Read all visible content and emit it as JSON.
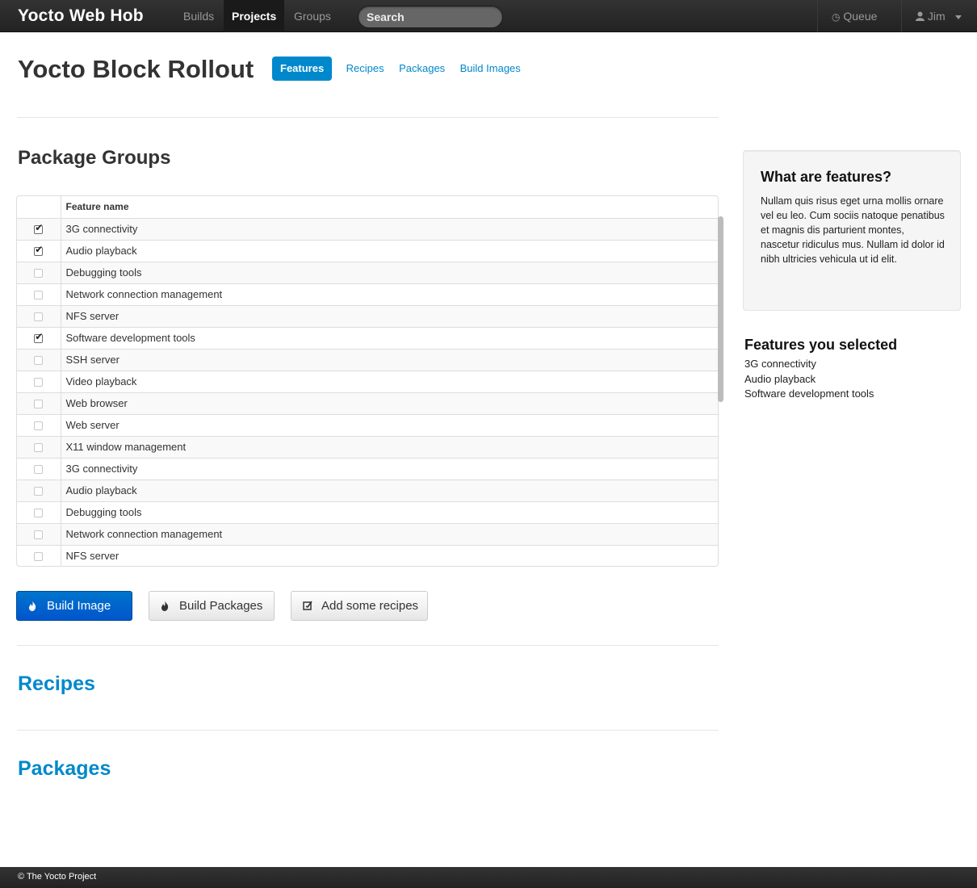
{
  "navbar": {
    "brand": "Yocto Web Hob",
    "links": [
      "Builds",
      "Projects",
      "Groups"
    ],
    "active": "Projects",
    "search_placeholder": "Search",
    "queue_label": "Queue",
    "user_name": "Jim"
  },
  "header": {
    "title": "Yocto Block Rollout",
    "tabs": [
      "Features",
      "Recipes",
      "Packages",
      "Build Images"
    ],
    "active_tab": "Features"
  },
  "package_groups": {
    "title": "Package Groups",
    "column_header": "Feature name",
    "rows": [
      {
        "name": "3G connectivity",
        "checked": true
      },
      {
        "name": "Audio playback",
        "checked": true
      },
      {
        "name": "Debugging tools",
        "checked": false
      },
      {
        "name": "Network connection management",
        "checked": false
      },
      {
        "name": "NFS server",
        "checked": false
      },
      {
        "name": "Software development tools",
        "checked": true
      },
      {
        "name": "SSH server",
        "checked": false
      },
      {
        "name": "Video playback",
        "checked": false
      },
      {
        "name": "Web browser",
        "checked": false
      },
      {
        "name": "Web server",
        "checked": false
      },
      {
        "name": "X11 window management",
        "checked": false
      },
      {
        "name": "3G connectivity",
        "checked": false
      },
      {
        "name": "Audio playback",
        "checked": false
      },
      {
        "name": "Debugging tools",
        "checked": false
      },
      {
        "name": "Network connection management",
        "checked": false
      },
      {
        "name": "NFS server",
        "checked": false
      }
    ]
  },
  "buttons": {
    "build_image": "Build Image",
    "build_packages": "Build Packages",
    "add_recipes": "Add some recipes"
  },
  "sections": {
    "recipes": "Recipes",
    "packages": "Packages"
  },
  "sidebar": {
    "info_title": "What are features?",
    "info_text": "Nullam quis risus eget urna mollis ornare vel eu leo. Cum sociis natoque penatibus et magnis dis parturient montes, nascetur ridiculus mus. Nullam id dolor id nibh ultricies vehicula ut id elit.",
    "selected_title": "Features you selected",
    "selected": [
      "3G connectivity",
      "Audio playback",
      "Software development tools"
    ]
  },
  "footer": {
    "text": "© The Yocto Project"
  },
  "colors": {
    "accent": "#0088cc",
    "primary_button": "#0065cc",
    "navbar": "#2b2b2b"
  }
}
